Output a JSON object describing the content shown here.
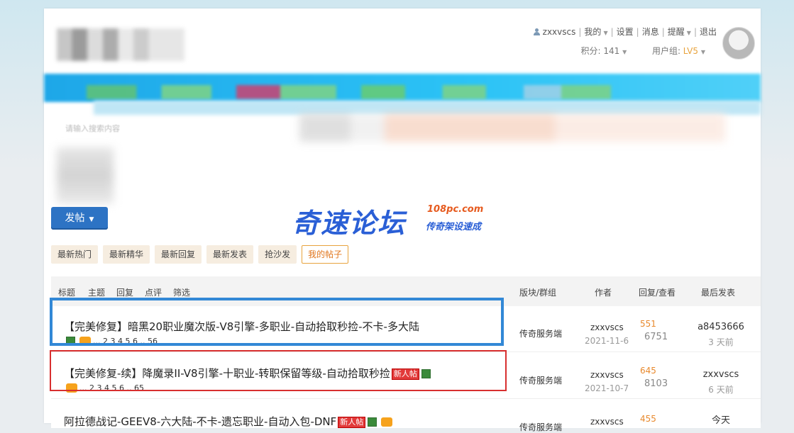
{
  "header": {
    "username": "zxxvscs",
    "menu": [
      "我的",
      "设置",
      "消息",
      "提醒",
      "退出"
    ],
    "points_label": "积分: 141",
    "group_label": "用户组: ",
    "group_level": "LV5"
  },
  "search": {
    "placeholder": "请输入搜索内容"
  },
  "post_button": {
    "label": "发帖"
  },
  "watermark": {
    "title": "奇速论坛",
    "site": "108pc.com",
    "slogan": "传奇架设速成"
  },
  "tabs": [
    "最新热门",
    "最新精华",
    "最新回复",
    "最新发表",
    "抢沙发",
    "我的帖子"
  ],
  "table": {
    "header_filters": [
      "标题",
      "主题",
      "回复",
      "点评",
      "筛选"
    ],
    "col_forum": "版块/群组",
    "col_author": "作者",
    "col_reply": "回复/查看",
    "col_last": "最后发表",
    "rows": [
      {
        "title": "【完美修复】暗黑20职业魔次版-V8引擎-多职业-自动拾取秒捡-不卡-多大陆",
        "pages": "... 2 3 4 5 6 .. 56",
        "forum": "传奇服务端",
        "author": "zxxvscs",
        "date": "2021-11-6",
        "replies": "551",
        "views": "6751",
        "last_user": "a8453666",
        "last_time": "3 天前"
      },
      {
        "title": "【完美修复-续】降魔录II-V8引擎-十职业-转职保留等级-自动拾取秒捡",
        "new_badge": "新人帖",
        "pages": "... 2 3 4 5 6 .. 65",
        "forum": "传奇服务端",
        "author": "zxxvscs",
        "date": "2021-10-7",
        "replies": "645",
        "views": "8103",
        "last_user": "zxxvscs",
        "last_time": "6 天前"
      },
      {
        "title": "阿拉德战记-GEEV8-六大陆-不卡-遗忘职业-自动入包-DNF",
        "new_badge": "新人帖",
        "forum": "传奇服务端",
        "author": "zxxvscs",
        "replies": "455",
        "last_user": "今天"
      }
    ]
  },
  "colors": {
    "accent_blue": "#3288d6",
    "highlight_red": "#d82f2f",
    "tab_active": "#e8a33d",
    "post_button": "#2d73c4"
  }
}
